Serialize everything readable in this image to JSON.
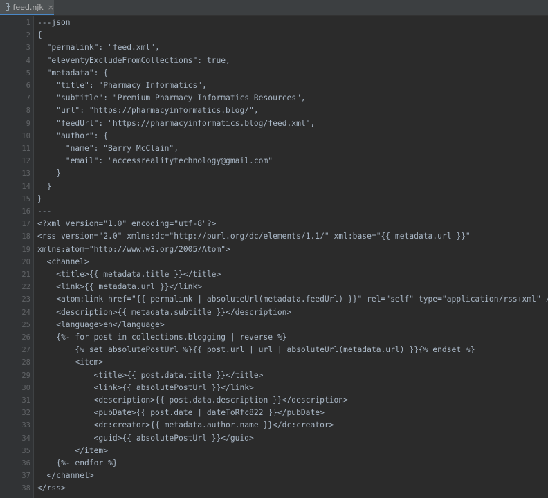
{
  "tab": {
    "filename": "feed.njk",
    "close": "×",
    "icon": "file-icon"
  },
  "colors": {
    "background": "#2b2b2b",
    "gutter": "#313335",
    "text": "#a9b7c6",
    "line_number": "#606366",
    "tab_accent": "#4a88c7"
  },
  "lines": [
    {
      "number": "1",
      "text": "---json"
    },
    {
      "number": "2",
      "text": "{"
    },
    {
      "number": "3",
      "text": "  \"permalink\": \"feed.xml\","
    },
    {
      "number": "4",
      "text": "  \"eleventyExcludeFromCollections\": true,"
    },
    {
      "number": "5",
      "text": "  \"metadata\": {"
    },
    {
      "number": "6",
      "text": "    \"title\": \"Pharmacy Informatics\","
    },
    {
      "number": "7",
      "text": "    \"subtitle\": \"Premium Pharmacy Informatics Resources\","
    },
    {
      "number": "8",
      "text": "    \"url\": \"https://pharmacyinformatics.blog/\","
    },
    {
      "number": "9",
      "text": "    \"feedUrl\": \"https://pharmacyinformatics.blog/feed.xml\","
    },
    {
      "number": "10",
      "text": "    \"author\": {"
    },
    {
      "number": "11",
      "text": "      \"name\": \"Barry McClain\","
    },
    {
      "number": "12",
      "text": "      \"email\": \"accessrealitytechnology@gmail.com\""
    },
    {
      "number": "13",
      "text": "    }"
    },
    {
      "number": "14",
      "text": "  }"
    },
    {
      "number": "15",
      "text": "}"
    },
    {
      "number": "16",
      "text": "---"
    },
    {
      "number": "17",
      "text": "<?xml version=\"1.0\" encoding=\"utf-8\"?>"
    },
    {
      "number": "18",
      "text": "<rss version=\"2.0\" xmlns:dc=\"http://purl.org/dc/elements/1.1/\" xml:base=\"{{ metadata.url }}\""
    },
    {
      "number": "19",
      "text": "xmlns:atom=\"http://www.w3.org/2005/Atom\">"
    },
    {
      "number": "20",
      "text": "  <channel>"
    },
    {
      "number": "21",
      "text": "    <title>{{ metadata.title }}</title>"
    },
    {
      "number": "22",
      "text": "    <link>{{ metadata.url }}</link>"
    },
    {
      "number": "23",
      "text": "    <atom:link href=\"{{ permalink | absoluteUrl(metadata.feedUrl) }}\" rel=\"self\" type=\"application/rss+xml\" />"
    },
    {
      "number": "24",
      "text": "    <description>{{ metadata.subtitle }}</description>"
    },
    {
      "number": "25",
      "text": "    <language>en</language>"
    },
    {
      "number": "26",
      "text": "    {%- for post in collections.blogging | reverse %}"
    },
    {
      "number": "27",
      "text": "        {% set absolutePostUrl %}{{ post.url | url | absoluteUrl(metadata.url) }}{% endset %}"
    },
    {
      "number": "28",
      "text": "        <item>"
    },
    {
      "number": "29",
      "text": "            <title>{{ post.data.title }}</title>"
    },
    {
      "number": "30",
      "text": "            <link>{{ absolutePostUrl }}</link>"
    },
    {
      "number": "31",
      "text": "            <description>{{ post.data.description }}</description>"
    },
    {
      "number": "32",
      "text": "            <pubDate>{{ post.date | dateToRfc822 }}</pubDate>"
    },
    {
      "number": "33",
      "text": "            <dc:creator>{{ metadata.author.name }}</dc:creator>"
    },
    {
      "number": "34",
      "text": "            <guid>{{ absolutePostUrl }}</guid>"
    },
    {
      "number": "35",
      "text": "        </item>"
    },
    {
      "number": "36",
      "text": "    {%- endfor %}"
    },
    {
      "number": "37",
      "text": "  </channel>"
    },
    {
      "number": "38",
      "text": "</rss>"
    }
  ]
}
